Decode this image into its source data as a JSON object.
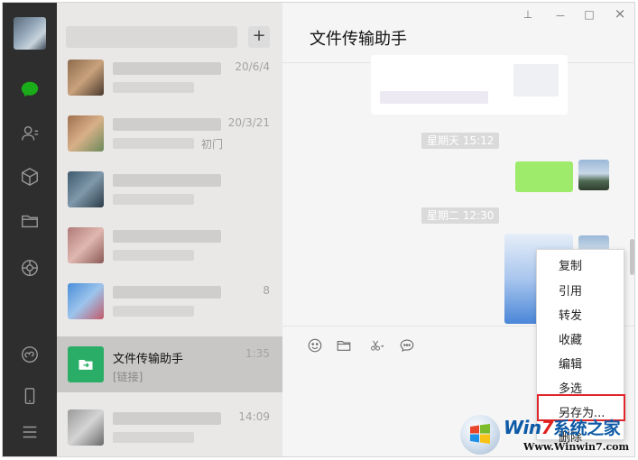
{
  "chat": {
    "title": "文件传输助手",
    "timestamps": [
      "星期天 15:12",
      "星期二 12:30"
    ],
    "window_controls": {
      "pin": "⊥",
      "minimize": "－",
      "maximize": "□",
      "close": "×"
    }
  },
  "sessions": [
    {
      "time": "20/6/4"
    },
    {
      "time": "20/3/21",
      "preview": "初门"
    },
    {
      "time": ""
    },
    {
      "time": ""
    },
    {
      "time": "8"
    },
    {
      "name": "文件传输助手",
      "last_message": "[链接]",
      "time": "1:35",
      "active": true
    },
    {
      "time": "14:09"
    }
  ],
  "search": {
    "add_label": "+"
  },
  "context_menu": {
    "items": [
      "复制",
      "引用",
      "转发",
      "收藏",
      "编辑",
      "多选",
      "另存为...",
      "删除"
    ],
    "highlighted": "另存为..."
  },
  "watermark": {
    "brand_prefix": "Win",
    "brand_seven": "7",
    "brand_suffix": "系统之家",
    "url": "Www.Winwin7.com"
  },
  "colors": {
    "nav_bg": "#2e2e2e",
    "accent_green": "#2aae67",
    "bubble_green": "#9eea6a",
    "highlight_red": "#e0262b"
  }
}
